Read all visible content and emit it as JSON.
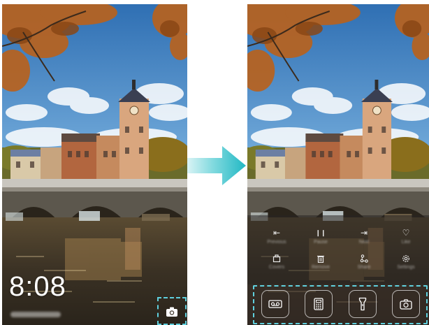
{
  "lock_screen": {
    "time": "8:08",
    "camera_shortcut_icon": "camera-icon"
  },
  "transition": {
    "arrow_icon": "arrow-right-icon",
    "arrow_color": "#3cc7cf"
  },
  "magazine_unlock": {
    "music_controls": [
      {
        "icon": "previous-icon",
        "glyph": "⇤",
        "label": "Previous"
      },
      {
        "icon": "pause-icon",
        "glyph": "❙❙",
        "label": "Pause"
      },
      {
        "icon": "next-icon",
        "glyph": "⇥",
        "label": "Next"
      },
      {
        "icon": "like-icon",
        "glyph": "♡",
        "label": "Like"
      }
    ],
    "action_controls": [
      {
        "icon": "covers-icon",
        "label": "Covers"
      },
      {
        "icon": "trash-icon",
        "label": "Remove"
      },
      {
        "icon": "share-icon",
        "label": "Share"
      },
      {
        "icon": "settings-icon",
        "label": "Settings"
      }
    ],
    "shortcuts": [
      {
        "icon": "recorder-icon"
      },
      {
        "icon": "calculator-icon"
      },
      {
        "icon": "flashlight-icon"
      },
      {
        "icon": "camera-icon"
      }
    ]
  },
  "colors": {
    "highlight": "#5fd0de",
    "sky": "#4a8fcc",
    "autumn_leaves": "#b8621e"
  }
}
